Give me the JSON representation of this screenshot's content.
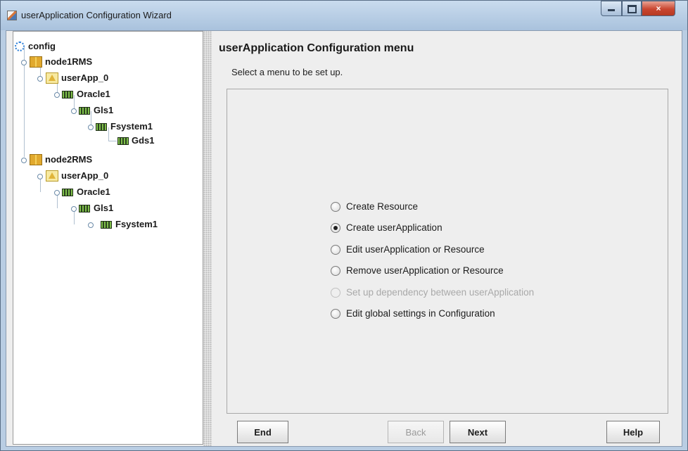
{
  "window": {
    "title": "userApplication Configuration Wizard",
    "icon": "java-app-icon",
    "controls": [
      "minimize-icon",
      "maximize-icon",
      "close-icon"
    ],
    "close_glyph": "×"
  },
  "tree": {
    "root": "config",
    "nodes": [
      {
        "label": "node1RMS",
        "icon": "node-icon"
      },
      {
        "label": "userApp_0",
        "icon": "userapp-icon"
      },
      {
        "label": "Oracle1",
        "icon": "resource-icon"
      },
      {
        "label": "Gls1",
        "icon": "resource-icon"
      },
      {
        "label": "Fsystem1",
        "icon": "resource-icon"
      },
      {
        "label": "Gds1",
        "icon": "resource-icon"
      },
      {
        "label": "node2RMS",
        "icon": "node-icon"
      },
      {
        "label": "userApp_0",
        "icon": "userapp-icon"
      },
      {
        "label": "Oracle1",
        "icon": "resource-icon"
      },
      {
        "label": "Gls1",
        "icon": "resource-icon"
      },
      {
        "label": "Fsystem1",
        "icon": "resource-icon"
      }
    ]
  },
  "main": {
    "title": "userApplication Configuration menu",
    "subtitle": "Select a menu to be set up.",
    "options": [
      {
        "label": "Create Resource",
        "selected": false,
        "enabled": true
      },
      {
        "label": "Create userApplication",
        "selected": true,
        "enabled": true
      },
      {
        "label": "Edit userApplication or Resource",
        "selected": false,
        "enabled": true
      },
      {
        "label": "Remove userApplication or Resource",
        "selected": false,
        "enabled": true
      },
      {
        "label": "Set up dependency between userApplication",
        "selected": false,
        "enabled": false
      },
      {
        "label": "Edit global settings in Configuration",
        "selected": false,
        "enabled": true
      }
    ]
  },
  "buttons": {
    "end": "End",
    "back": "Back",
    "next": "Next",
    "help": "Help"
  }
}
